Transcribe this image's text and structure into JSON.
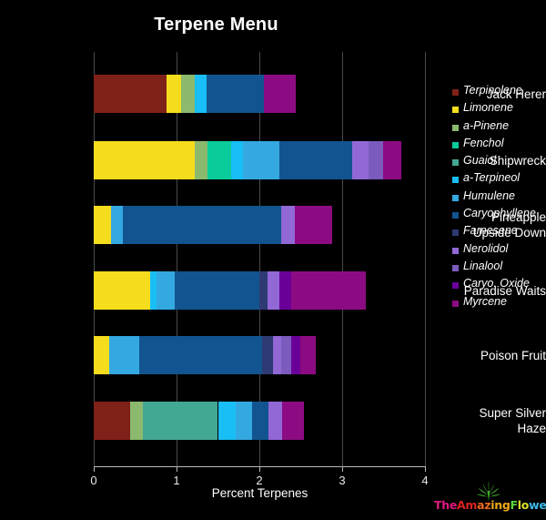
{
  "chart_data": {
    "type": "bar",
    "orientation": "horizontal",
    "stacked": true,
    "title": "Terpene Menu",
    "xlabel": "Percent Terpenes",
    "ylabel": "",
    "xlim": [
      0,
      4
    ],
    "xticks": [
      0,
      1,
      2,
      3,
      4
    ],
    "xtick_labels": [
      "0",
      "1",
      "2",
      "3",
      "4"
    ],
    "grid": true,
    "grid_axis": "x",
    "legend_position": "right",
    "background": "#000000",
    "categories": [
      "Jack Herer",
      "Shipwreck",
      "Pineapple Upside Down",
      "Paradise Waits",
      "Poison Fruit",
      "Super Silver Haze"
    ],
    "category_label_lines": [
      [
        "Jack Herer"
      ],
      [
        "Shipwreck"
      ],
      [
        "Pineapple",
        "Upside Down"
      ],
      [
        "Paradise Waits"
      ],
      [
        "Poison Fruit"
      ],
      [
        "Super Silver",
        "Haze"
      ]
    ],
    "series": [
      {
        "name": "Terpinolene",
        "color": "#7f2019",
        "values": [
          0.88,
          0.0,
          0.0,
          0.0,
          0.0,
          0.44
        ]
      },
      {
        "name": "Limonene",
        "color": "#f5dd1e",
        "values": [
          0.18,
          1.22,
          0.21,
          0.68,
          0.19,
          0.0
        ]
      },
      {
        "name": "a-Pinene",
        "color": "#8bb96e",
        "values": [
          0.16,
          0.15,
          0.0,
          0.0,
          0.0,
          0.15
        ]
      },
      {
        "name": "Fenchol",
        "color": "#0acc9b",
        "values": [
          0.0,
          0.29,
          0.0,
          0.0,
          0.0,
          0.0
        ]
      },
      {
        "name": "Guaiol",
        "color": "#43a893",
        "values": [
          0.0,
          0.0,
          0.0,
          0.0,
          0.0,
          0.91
        ]
      },
      {
        "name": "a-Terpineol",
        "color": "#18bef5",
        "values": [
          0.14,
          0.14,
          0.0,
          0.08,
          0.0,
          0.21
        ]
      },
      {
        "name": "Humulene",
        "color": "#34a8e0",
        "values": [
          0.0,
          0.44,
          0.14,
          0.22,
          0.36,
          0.2
        ]
      },
      {
        "name": "Caryophyllene",
        "color": "#11548f",
        "values": [
          0.69,
          0.88,
          1.91,
          1.02,
          1.48,
          0.2
        ]
      },
      {
        "name": "Farnesene",
        "color": "#2e3a73",
        "values": [
          0.0,
          0.0,
          0.0,
          0.1,
          0.13,
          0.0
        ]
      },
      {
        "name": "Nerolidol",
        "color": "#9168d6",
        "values": [
          0.0,
          0.2,
          0.17,
          0.14,
          0.1,
          0.16
        ]
      },
      {
        "name": "Linalool",
        "color": "#7b5bbd",
        "values": [
          0.0,
          0.17,
          0.0,
          0.0,
          0.12,
          0.0
        ]
      },
      {
        "name": "Caryo. Oxide",
        "color": "#6b0099",
        "values": [
          0.0,
          0.0,
          0.0,
          0.14,
          0.11,
          0.0
        ]
      },
      {
        "name": "Myrcene",
        "color": "#8c0b82",
        "values": [
          0.39,
          0.22,
          0.45,
          0.91,
          0.19,
          0.27
        ]
      }
    ],
    "totals": [
      2.44,
      3.71,
      2.88,
      3.29,
      2.68,
      2.54
    ]
  },
  "legend": {
    "items": [
      {
        "label": "Terpinolene",
        "color": "#7f2019"
      },
      {
        "label": "Limonene",
        "color": "#f5dd1e"
      },
      {
        "label": "a-Pinene",
        "color": "#8bb96e"
      },
      {
        "label": "Fenchol",
        "color": "#0acc9b"
      },
      {
        "label": "Guaiol",
        "color": "#43a893"
      },
      {
        "label": "a-Terpineol",
        "color": "#18bef5"
      },
      {
        "label": "Humulene",
        "color": "#34a8e0"
      },
      {
        "label": "Caryophyllene",
        "color": "#11548f"
      },
      {
        "label": "Farnesene",
        "color": "#2e3a73"
      },
      {
        "label": "Nerolidol",
        "color": "#9168d6"
      },
      {
        "label": "Linalool",
        "color": "#7b5bbd"
      },
      {
        "label": "Caryo. Oxide",
        "color": "#6b0099"
      },
      {
        "label": "Myrcene",
        "color": "#8c0b82"
      }
    ]
  },
  "watermark": {
    "text": "TheAmazingFlower",
    "letters": [
      {
        "ch": "T",
        "color": "#e0197f"
      },
      {
        "ch": "h",
        "color": "#e0197f"
      },
      {
        "ch": "e",
        "color": "#e0197f"
      },
      {
        "ch": "A",
        "color": "#d92121"
      },
      {
        "ch": "m",
        "color": "#d92121"
      },
      {
        "ch": "a",
        "color": "#e86a1f"
      },
      {
        "ch": "z",
        "color": "#e86a1f"
      },
      {
        "ch": "i",
        "color": "#f0a81c"
      },
      {
        "ch": "n",
        "color": "#f0a81c"
      },
      {
        "ch": "g",
        "color": "#f0a81c"
      },
      {
        "ch": "F",
        "color": "#5bd43a"
      },
      {
        "ch": "l",
        "color": "#d8e02a"
      },
      {
        "ch": "o",
        "color": "#d8e02a"
      },
      {
        "ch": "w",
        "color": "#3bb9e8"
      },
      {
        "ch": "e",
        "color": "#3bb9e8"
      },
      {
        "ch": "r",
        "color": "#3bb9e8"
      }
    ],
    "leaf_color": "#3faa2b",
    "leaf_icon": "cannabis-leaf-icon"
  }
}
